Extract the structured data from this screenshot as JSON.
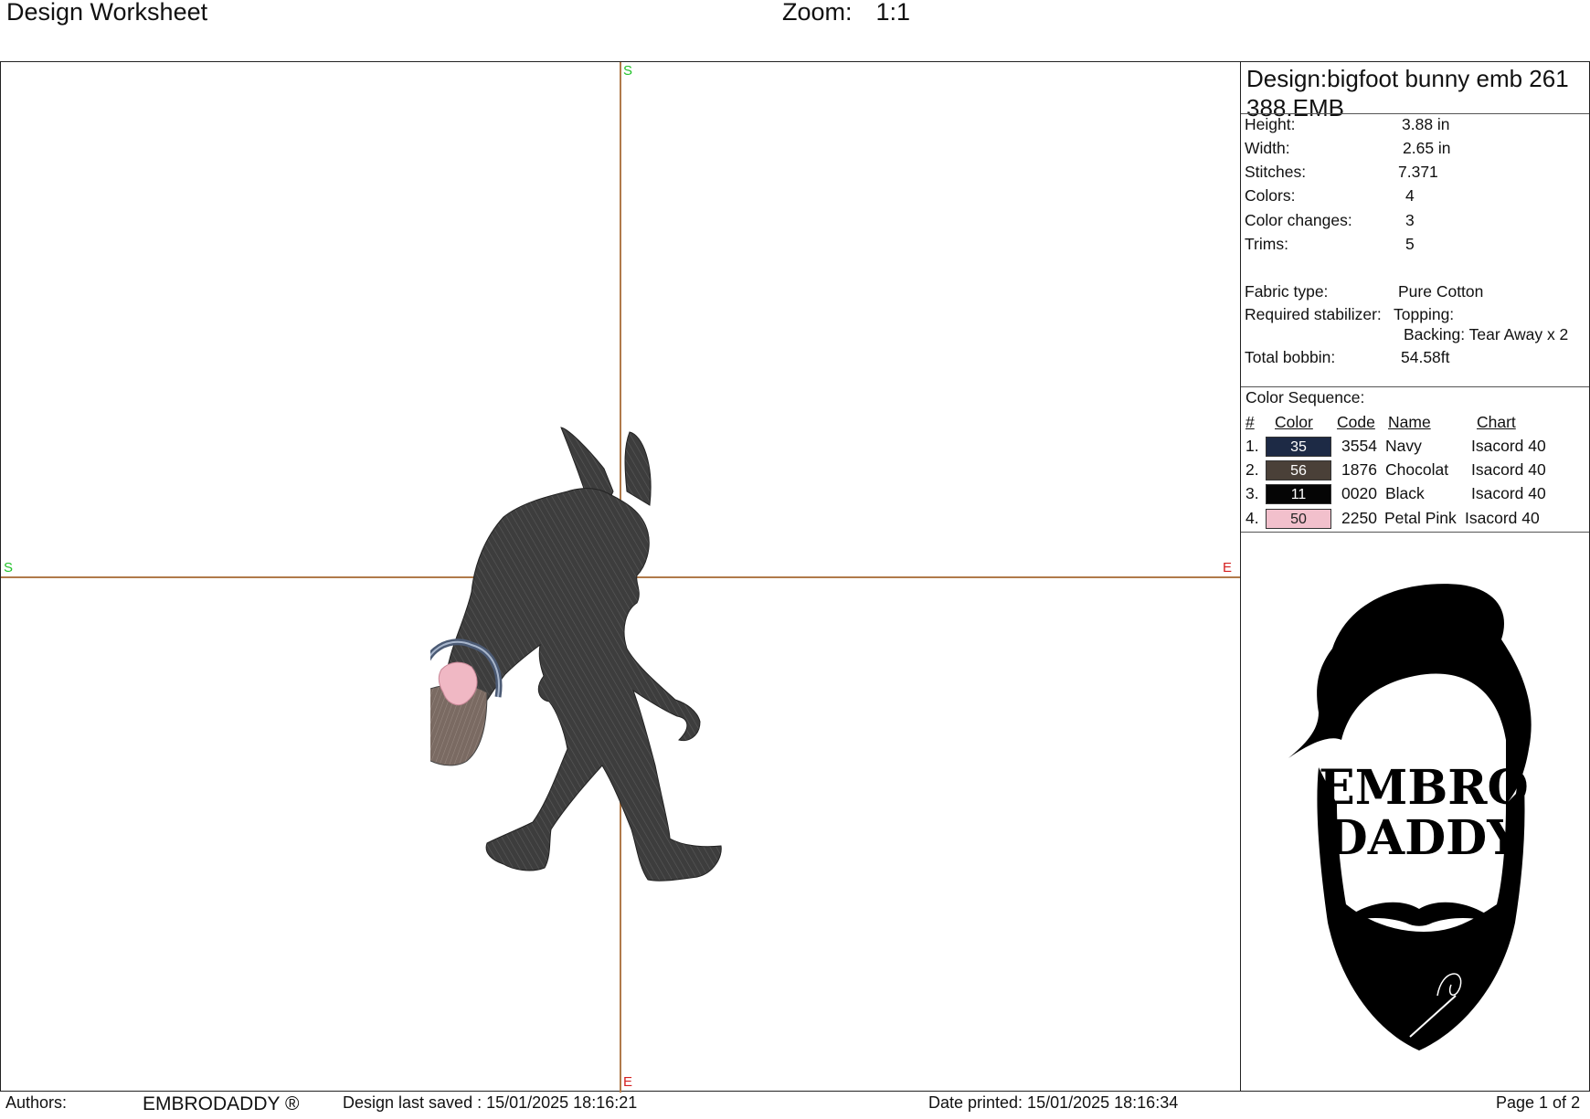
{
  "header": {
    "title": "Design Worksheet",
    "zoom_label": "Zoom:",
    "zoom_value": "1:1"
  },
  "canvas": {
    "axis_top": "S",
    "axis_left": "S",
    "axis_right": "E",
    "axis_bottom": "E"
  },
  "design": {
    "name": "Design:bigfoot bunny emb 261 388.EMB",
    "info": [
      {
        "label": "Height:",
        "value": "3.88 in"
      },
      {
        "label": "Width:",
        "value": "2.65 in"
      },
      {
        "label": "Stitches:",
        "value": "7.371"
      },
      {
        "label": "Colors:",
        "value": "4"
      },
      {
        "label": "Color changes:",
        "value": "3"
      },
      {
        "label": "Trims:",
        "value": "5"
      }
    ],
    "fabric_type_label": "Fabric type:",
    "fabric_type": "Pure Cotton",
    "stabilizer_label": "Required stabilizer:",
    "topping": "Topping:",
    "backing": "Backing: Tear Away x 2",
    "bobbin_label": "Total bobbin:",
    "bobbin": "54.58ft"
  },
  "color_sequence": {
    "title": "Color Sequence:",
    "headers": {
      "num": "#",
      "color": "Color",
      "code": "Code",
      "name": "Name",
      "chart": "Chart"
    },
    "rows": [
      {
        "num": "1.",
        "swatch": "35",
        "hex": "#1d2a45",
        "code": "3554",
        "name": "Navy",
        "chart": "Isacord 40"
      },
      {
        "num": "2.",
        "swatch": "56",
        "hex": "#4a4038",
        "code": "1876",
        "name": "Chocolat",
        "chart": "Isacord 40"
      },
      {
        "num": "3.",
        "swatch": "11",
        "hex": "#050505",
        "code": "0020",
        "name": "Black",
        "chart": "Isacord 40"
      },
      {
        "num": "4.",
        "swatch": "50",
        "hex": "#f2c0cc",
        "code": "2250",
        "name": "Petal Pink",
        "chart": "Isacord 40"
      }
    ]
  },
  "logo": {
    "line1": "EMBRO",
    "line2": "DADDY"
  },
  "footer": {
    "authors_label": "Authors:",
    "author": "EMBRODADDY ®",
    "saved": "Design last saved : 15/01/2025 18:16:21",
    "printed": "Date printed: 15/01/2025 18:16:34",
    "page": "Page 1 of 2"
  }
}
